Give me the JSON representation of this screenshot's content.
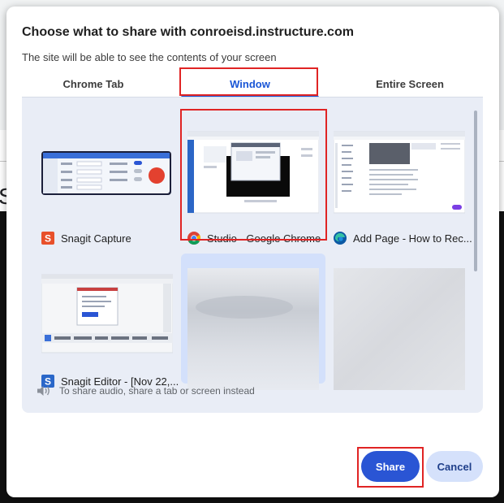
{
  "dialog": {
    "title": "Choose what to share with conroeisd.instructure.com",
    "subtitle": "The site will be able to see the contents of your screen"
  },
  "tabs": [
    {
      "label": "Chrome Tab",
      "selected": false
    },
    {
      "label": "Window",
      "selected": true
    },
    {
      "label": "Entire Screen",
      "selected": false
    }
  ],
  "windows": [
    {
      "label": "Snagit Capture",
      "icon": "snagit-icon",
      "selected": false
    },
    {
      "label": "Studio - Google Chrome",
      "icon": "chrome-icon",
      "selected": true
    },
    {
      "label": "Add Page - How to Rec...",
      "icon": "edge-icon",
      "selected": false
    },
    {
      "label": "Snagit Editor - [Nov 22,...",
      "icon": "snagit-icon",
      "selected": false
    }
  ],
  "audio_note": "To share audio, share a tab or screen instead",
  "buttons": {
    "share": "Share",
    "cancel": "Cancel"
  },
  "colors": {
    "accent": "#2a55d4",
    "highlight": "#e02424",
    "panel": "#e9edf6"
  }
}
